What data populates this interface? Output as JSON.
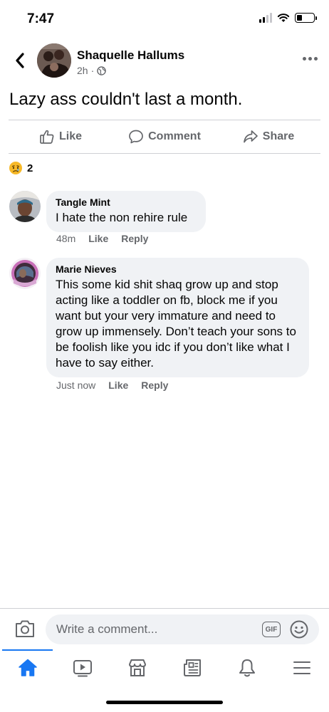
{
  "status_bar": {
    "time": "7:47",
    "battery_level": 0.3
  },
  "post": {
    "author": "Shaquelle Hallums",
    "time": "2h",
    "separator": "·",
    "privacy_icon": "globe-icon",
    "text": "Lazy ass couldn't last a month."
  },
  "actions": {
    "like": "Like",
    "comment": "Comment",
    "share": "Share"
  },
  "reactions": {
    "icon": "sad-face-icon",
    "count": "2"
  },
  "comments": [
    {
      "author": "Tangle Mint",
      "text": "I hate the non rehire rule",
      "time": "48m",
      "like": "Like",
      "reply": "Reply"
    },
    {
      "author": "Marie Nieves",
      "text": "This some kid shit shaq grow up and stop acting like a toddler on fb, block me if you want but your very immature and need to grow up immensely. Don’t teach your sons to be foolish like you idc if you don’t like what I have to say either.",
      "time": "Just now",
      "like": "Like",
      "reply": "Reply"
    }
  ],
  "composer": {
    "placeholder": "Write a comment...",
    "gif_label": "GIF"
  },
  "nav": [
    "home-icon",
    "watch-icon",
    "marketplace-icon",
    "news-icon",
    "notifications-icon",
    "menu-icon"
  ],
  "colors": {
    "accent": "#1877f2",
    "secondary_text": "#65676b",
    "bubble": "#f0f2f5"
  }
}
